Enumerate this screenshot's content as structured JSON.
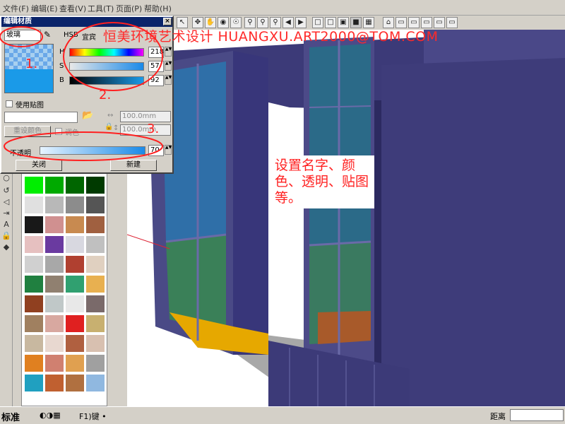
{
  "menu": [
    "文件(F)",
    "编辑(E)",
    "查看(V)",
    "工具(T)",
    "页面(P)",
    "帮助(H)"
  ],
  "toolbar_icons": [
    "arrow-icon",
    "move-icon",
    "pan-icon",
    "orbit-icon",
    "walk-icon",
    "zoom-icon",
    "zoom-window-icon",
    "zoom-extents-icon",
    "prev-view-icon",
    "next-view-icon",
    "xray-icon",
    "wireframe-icon",
    "hidden-line-icon",
    "shaded-icon",
    "textured-icon",
    "iso-view-icon",
    "top-view-icon",
    "front-view-icon",
    "right-view-icon",
    "back-view-icon",
    "left-view-icon"
  ],
  "dialog": {
    "title": "编辑材质",
    "close": "×",
    "name_value": "玻璃",
    "color_mode": "HSB",
    "color_mode_alt": "宜宾",
    "h_label": "H",
    "s_label": "S",
    "b_label": "B",
    "h_value": "218",
    "s_value": "57",
    "b_value": "92",
    "use_texture_label": "使用贴图",
    "width_value": "100.0mm",
    "height_value": "100.0mm",
    "reset_color_label": "重设颜色",
    "colorize_label": "调色",
    "opacity_label": "不透明",
    "opacity_value": "70",
    "close_button": "关闭",
    "new_button": "新建"
  },
  "overlay": {
    "banner": "恒美环境艺术设计 HUANGXU.ART2000@TOM.COM",
    "note": "设置名字、颜色、透明、贴图等。",
    "anno_1": "1.",
    "anno_2": "2.",
    "anno_3": "3."
  },
  "status": {
    "mode": "标准",
    "hint": "F1)键 •",
    "distance_label": "距离"
  },
  "colors": {
    "swatch_colors": [
      "#ff3a28",
      "#ffe800",
      "#2050ff",
      "#00c0ff",
      "#00ff00",
      "#00cc00",
      "#006600",
      "#004400",
      "#d8d8d8",
      "#b0b0b0",
      "#808080",
      "#505050",
      "#202020"
    ]
  }
}
